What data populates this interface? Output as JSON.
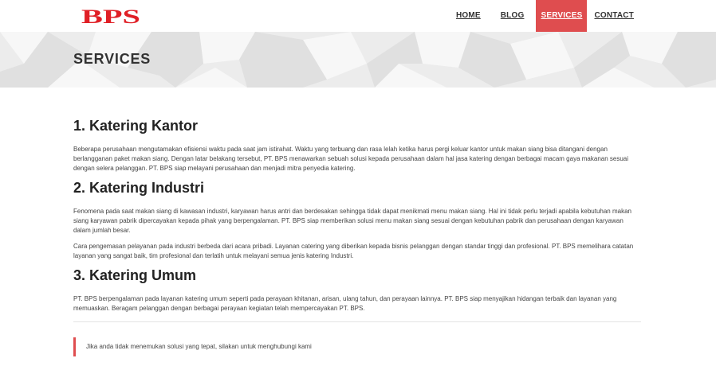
{
  "header": {
    "logo_text": "BPS",
    "nav": [
      {
        "label": "HOME"
      },
      {
        "label": "BLOG"
      },
      {
        "label": "SERVICES"
      },
      {
        "label": "CONTACT"
      }
    ]
  },
  "banner": {
    "title": "SERVICES"
  },
  "sections": [
    {
      "heading": "1. Katering Kantor",
      "paragraphs": [
        "Beberapa perusahaan mengutamakan efisiensi waktu pada saat jam istirahat. Waktu yang terbuang dan rasa lelah ketika harus pergi keluar kantor untuk makan siang bisa ditangani dengan berlangganan paket makan siang. Dengan latar belakang tersebut, PT. BPS menawarkan sebuah solusi kepada perusahaan dalam hal jasa katering dengan berbagai macam gaya makanan sesuai dengan selera pelanggan. PT. BPS siap melayani perusahaan dan menjadi mitra penyedia katering."
      ]
    },
    {
      "heading": "2. Katering Industri",
      "paragraphs": [
        "Fenomena pada saat makan siang di kawasan industri, karyawan harus antri dan berdesakan sehingga tidak dapat menikmati menu makan siang. Hal ini tidak perlu terjadi apabila kebutuhan makan siang karyawan pabrik dipercayakan kepada pihak yang berpengalaman. PT. BPS siap memberikan solusi menu makan siang sesuai dengan kebutuhan pabrik dan perusahaan dengan karyawan dalam jumlah besar.",
        "Cara pengemasan pelayanan pada industri berbeda dari acara pribadi. Layanan catering yang diberikan kepada bisnis pelanggan dengan standar tinggi dan profesional. PT. BPS memelihara catatan layanan yang sangat baik, tim profesional dan terlatih untuk melayani semua jenis katering Industri."
      ]
    },
    {
      "heading": "3. Katering Umum",
      "paragraphs": [
        "PT. BPS berpengalaman pada layanan katering umum seperti pada perayaan khitanan, arisan, ulang tahun, dan perayaan lainnya. PT. BPS siap menyajikan hidangan terbaik dan layanan yang memuaskan. Beragam pelanggan dengan berbagai perayaan kegiatan telah mempercayakan PT. BPS."
      ]
    }
  ],
  "note": {
    "text": "Jika anda tidak menemukan solusi yang tepat, silakan untuk menghubungi kami"
  },
  "colors": {
    "accent": "#df4d4f",
    "logo": "#e01f26",
    "banner_bg": "#ececec"
  },
  "icons": {
    "logo": "bps-logo"
  }
}
